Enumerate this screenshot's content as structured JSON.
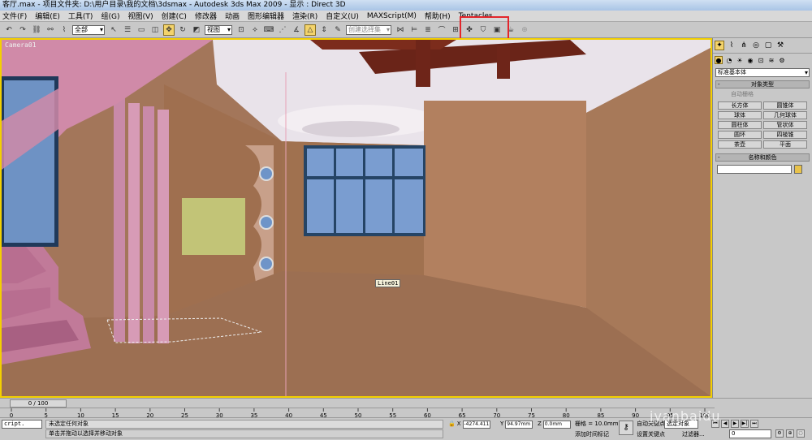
{
  "window": {
    "title": "客厅.max    - 项目文件夹: D:\\用户目录\\我的文档\\3dsmax    - Autodesk 3ds Max  2009        - 显示 : Direct 3D"
  },
  "menu": [
    "文件(F)",
    "编辑(E)",
    "工具(T)",
    "组(G)",
    "视图(V)",
    "创建(C)",
    "修改器",
    "动画",
    "图形编辑器",
    "渲染(R)",
    "自定义(U)",
    "MAXScript(M)",
    "帮助(H)",
    "Tentacles"
  ],
  "toolbar": {
    "selection_filter": "全部",
    "ref_coord": "视图",
    "named_selection_placeholder": "创建选择集"
  },
  "viewport": {
    "label": "Camera01",
    "object_tag": "Line01"
  },
  "command_panel": {
    "category": "标准基本体",
    "rollout_object_type": "对象类型",
    "autogrid": "自动栅格",
    "object_buttons": [
      "长方体",
      "圆锥体",
      "球体",
      "几何球体",
      "圆柱体",
      "管状体",
      "圆环",
      "四棱锥",
      "茶壶",
      "平面"
    ],
    "rollout_name_color": "名称和颜色",
    "swatch_color": "#e8c24a"
  },
  "timeline": {
    "frame_indicator": "0 / 100",
    "ruler_ticks": [
      "0",
      "5",
      "10",
      "15",
      "20",
      "25",
      "30",
      "35",
      "40",
      "45",
      "50",
      "55",
      "60",
      "65",
      "70",
      "75",
      "80",
      "85",
      "90",
      "95",
      "100"
    ]
  },
  "statusbar": {
    "script_label": "cript.",
    "prompt_line1": "未选定任何对象",
    "prompt_line2": "单击并拖动以选择并移动对象",
    "x_label": "X",
    "x_value": "-4274.411",
    "y_label": "Y",
    "y_value": "94.97mm",
    "z_label": "Z",
    "z_value": "0.0mm",
    "grid": "栅格 = 10.0mm",
    "add_time_tag": "添加时间标记",
    "auto_key": "自动关键点",
    "selected_set": "选定对象",
    "set_key": "设置关键点",
    "filters": "过滤器...",
    "current_frame": "0"
  },
  "watermark": "jyanbaidu"
}
